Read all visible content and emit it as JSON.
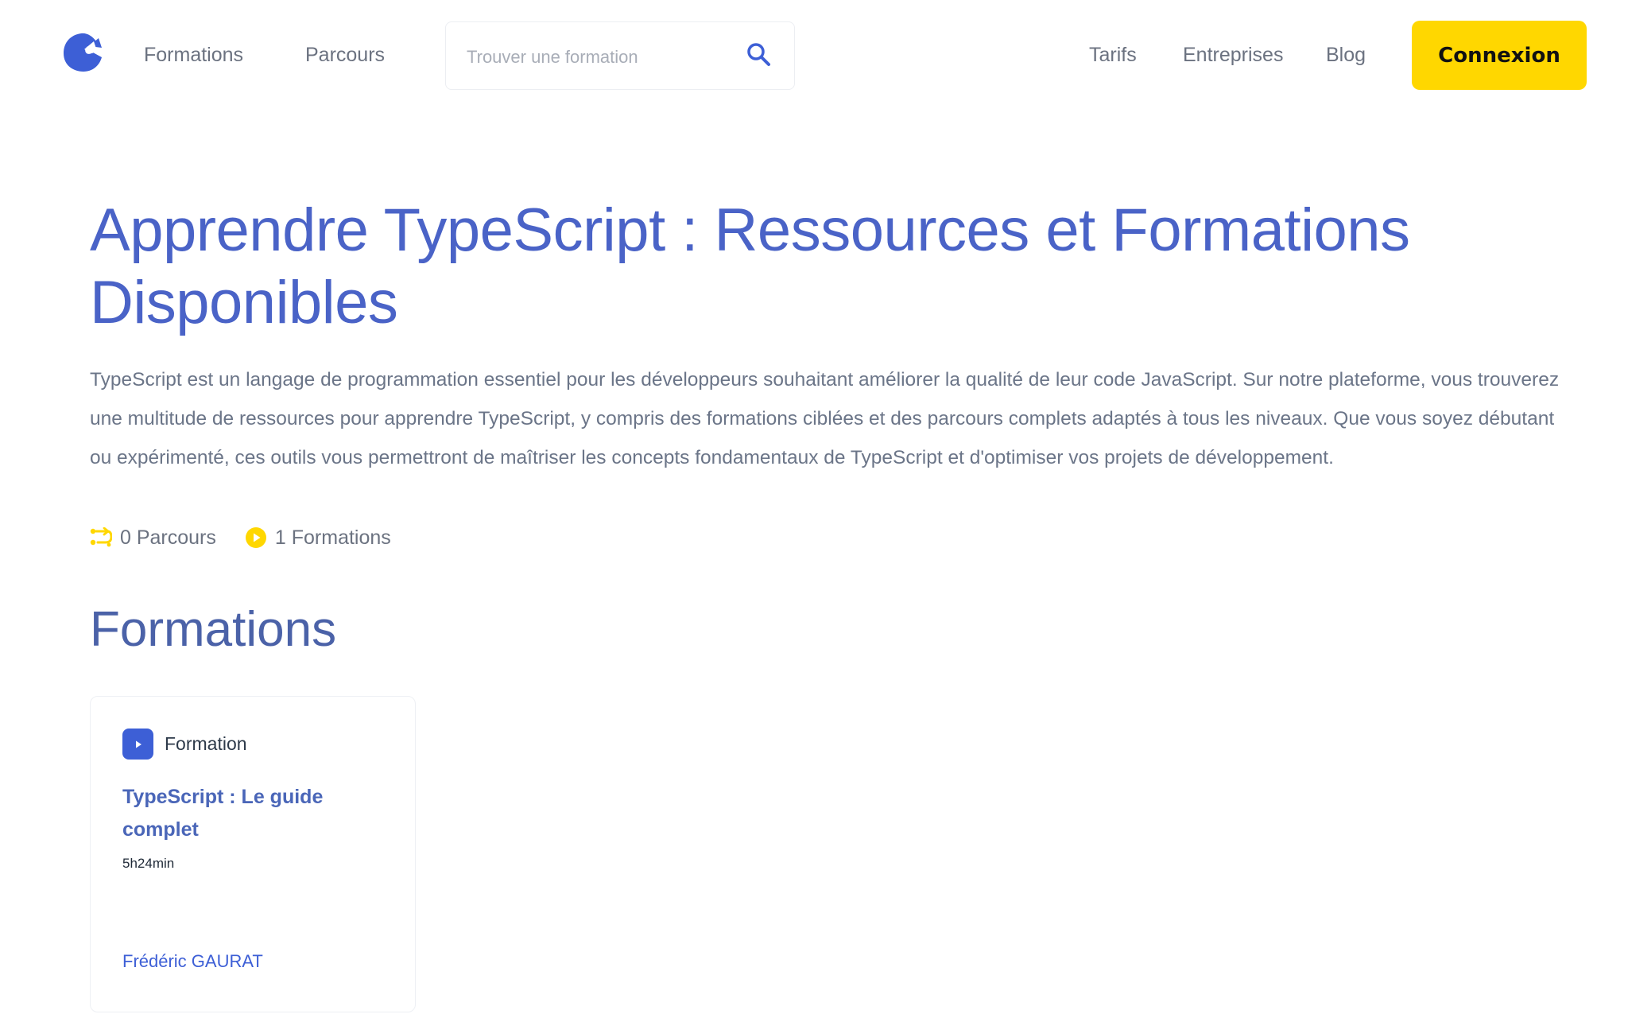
{
  "header": {
    "nav_left": [
      "Formations",
      "Parcours"
    ],
    "search": {
      "placeholder": "Trouver une formation",
      "value": ""
    },
    "nav_right": [
      "Tarifs",
      "Entreprises",
      "Blog"
    ],
    "cta_label": "Connexion"
  },
  "main": {
    "title": "Apprendre TypeScript : Ressources et Formations Disponibles",
    "description": "TypeScript est un langage de programmation essentiel pour les développeurs souhaitant améliorer la qualité de leur code JavaScript. Sur notre plateforme, vous trouverez une multitude de ressources pour apprendre TypeScript, y compris des formations ciblées et des parcours complets adaptés à tous les niveaux. Que vous soyez débutant ou expérimenté, ces outils vous permettront de maîtriser les concepts fondamentaux de TypeScript et d'optimiser vos projets de développement.",
    "stats": {
      "parcours": "0 Parcours",
      "formations": "1 Formations"
    },
    "section_title": "Formations",
    "cards": [
      {
        "badge": "Formation",
        "title": "TypeScript : Le guide complet",
        "duration": "5h24min",
        "author": "Frédéric GAURAT"
      }
    ]
  },
  "colors": {
    "brand_blue": "#3d5fd6",
    "title_blue": "#4a63c7",
    "accent_yellow": "#ffd700"
  },
  "icons": [
    "logo-icon",
    "search-icon",
    "parcours-icon",
    "play-circle-icon",
    "play-icon"
  ]
}
